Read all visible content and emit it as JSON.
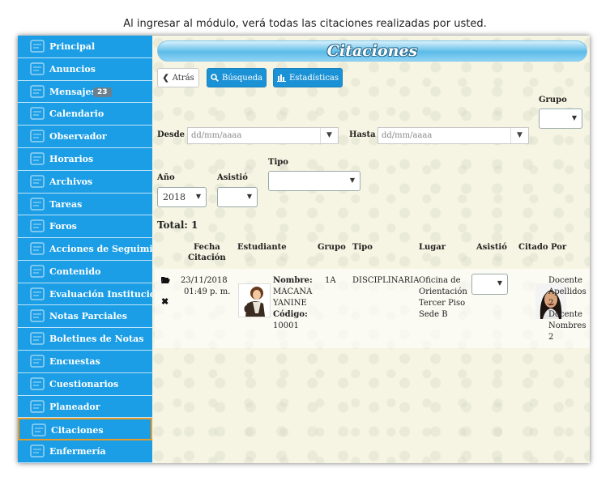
{
  "caption": "Al ingresar al módulo, verá todas las citaciones realizadas por usted.",
  "sidebar": {
    "items": [
      {
        "label": "Principal",
        "icon": "home-icon"
      },
      {
        "label": "Anuncios",
        "icon": "megaphone-icon"
      },
      {
        "label": "Mensajes",
        "icon": "envelope-icon",
        "badge": "23"
      },
      {
        "label": "Calendario",
        "icon": "calendar-icon"
      },
      {
        "label": "Observador",
        "icon": "eye-icon"
      },
      {
        "label": "Horarios",
        "icon": "clock-icon"
      },
      {
        "label": "Archivos",
        "icon": "files-icon"
      },
      {
        "label": "Tareas",
        "icon": "pencil-icon"
      },
      {
        "label": "Foros",
        "icon": "people-icon"
      },
      {
        "label": "Acciones de Seguimiento",
        "icon": "gear-icon"
      },
      {
        "label": "Contenido",
        "icon": "book-icon"
      },
      {
        "label": "Evaluación Institucional",
        "icon": "checklist-icon"
      },
      {
        "label": "Notas Parciales",
        "icon": "grade-icon"
      },
      {
        "label": "Boletines de Notas",
        "icon": "building-icon"
      },
      {
        "label": "Encuestas",
        "icon": "survey-icon"
      },
      {
        "label": "Cuestionarios",
        "icon": "target-icon"
      },
      {
        "label": "Planeador",
        "icon": "planner-icon"
      },
      {
        "label": "Citaciones",
        "icon": "calendar-clock-icon",
        "active": true
      },
      {
        "label": "Enfermería",
        "icon": "nurse-icon"
      }
    ]
  },
  "header": {
    "title": "Citaciones"
  },
  "toolbar": {
    "back": "Atrás",
    "search": "Búsqueda",
    "stats": "Estadísticas"
  },
  "filters": {
    "grupo_label": "Grupo",
    "desde_label": "Desde",
    "desde_placeholder": "dd/mm/aaaa",
    "hasta_label": "Hasta",
    "hasta_placeholder": "dd/mm/aaaa",
    "tipo_label": "Tipo",
    "anio_label": "Año",
    "anio_value": "2018",
    "asistio_label": "Asistió"
  },
  "total": "Total: 1",
  "table": {
    "headers": {
      "fecha_1": "Fecha",
      "fecha_2": "Citación",
      "estudiante": "Estudiante",
      "grupo": "Grupo",
      "tipo": "Tipo",
      "lugar": "Lugar",
      "asistio": "Asistió",
      "citado_por": "Citado Por"
    },
    "rows": [
      {
        "fecha": "23/11/2018",
        "hora": "01:49 p. m.",
        "nombre_label": "Nombre:",
        "nombre_1": "MACANA",
        "nombre_2": "YANINE",
        "codigo_label": "Código:",
        "codigo": "10001",
        "grupo": "1A",
        "tipo": "DISCIPLINARIA",
        "lugar_1": "Oficina de",
        "lugar_2": "Orientación",
        "lugar_3": "Tercer Piso",
        "lugar_4": "Sede B",
        "docente_1": "Docente",
        "docente_2": "Apellidos",
        "docente_3": "2",
        "docente_4": "Docente",
        "docente_5": "Nombres",
        "docente_6": "2"
      }
    ]
  }
}
